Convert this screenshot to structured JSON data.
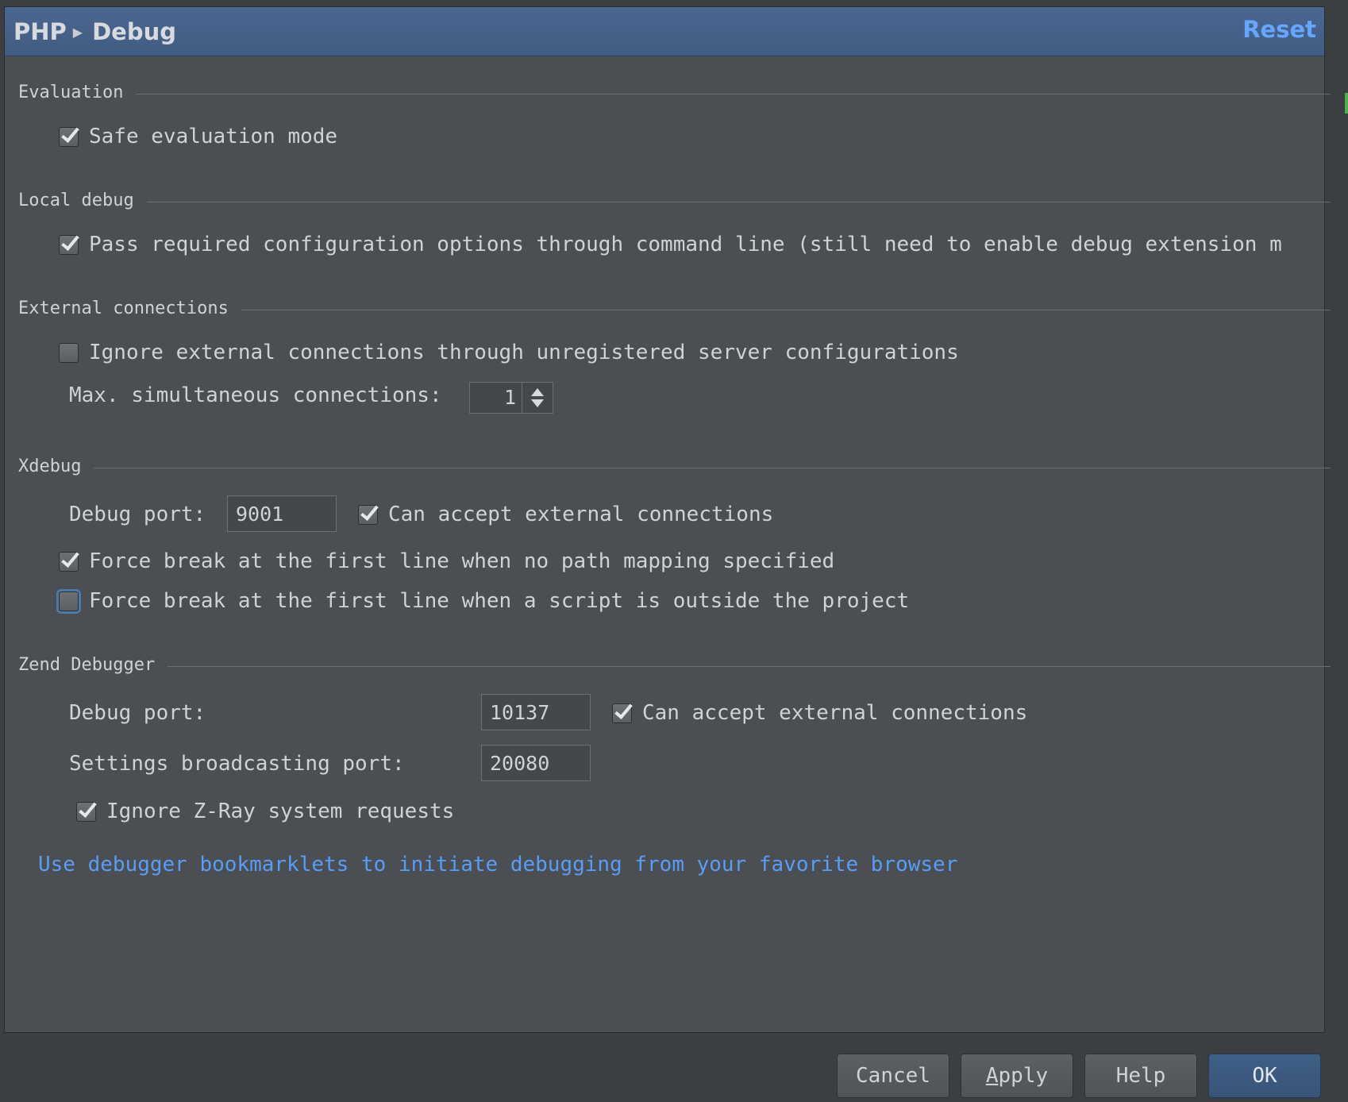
{
  "header": {
    "breadcrumb": [
      "PHP",
      "Debug"
    ],
    "reset_label": "Reset"
  },
  "sections": {
    "evaluation": {
      "title": "Evaluation",
      "safe_mode_label": "Safe evaluation mode",
      "safe_mode_checked": true
    },
    "local_debug": {
      "title": "Local debug",
      "pass_options_label": "Pass required configuration options through command line (still need to enable debug extension m",
      "pass_options_checked": true
    },
    "external": {
      "title": "External connections",
      "ignore_label": "Ignore external connections through unregistered server configurations",
      "ignore_checked": false,
      "max_label": "Max. simultaneous connections:",
      "max_value": "1"
    },
    "xdebug": {
      "title": "Xdebug",
      "port_label": "Debug port:",
      "port_value": "9001",
      "accept_label": "Can accept external connections",
      "accept_checked": true,
      "force_no_mapping_label": "Force break at the first line when no path mapping specified",
      "force_no_mapping_checked": true,
      "force_outside_label": "Force break at the first line when a script is outside the project",
      "force_outside_checked": false
    },
    "zend": {
      "title": "Zend Debugger",
      "port_label": "Debug port:",
      "port_value": "10137",
      "accept_label": "Can accept external connections",
      "accept_checked": true,
      "broadcast_label": "Settings broadcasting port:",
      "broadcast_value": "20080",
      "zray_label": "Ignore Z-Ray system requests",
      "zray_checked": true
    }
  },
  "bookmarklets_link": "Use debugger bookmarklets to initiate debugging from your favorite browser",
  "buttons": {
    "cancel": "Cancel",
    "apply_mnemonic": "A",
    "apply_rest": "pply",
    "help": "Help",
    "ok": "OK"
  },
  "colors": {
    "background": "#4b4e52",
    "header": "#445f85",
    "link": "#589df6",
    "reset": "#66a6ff"
  }
}
